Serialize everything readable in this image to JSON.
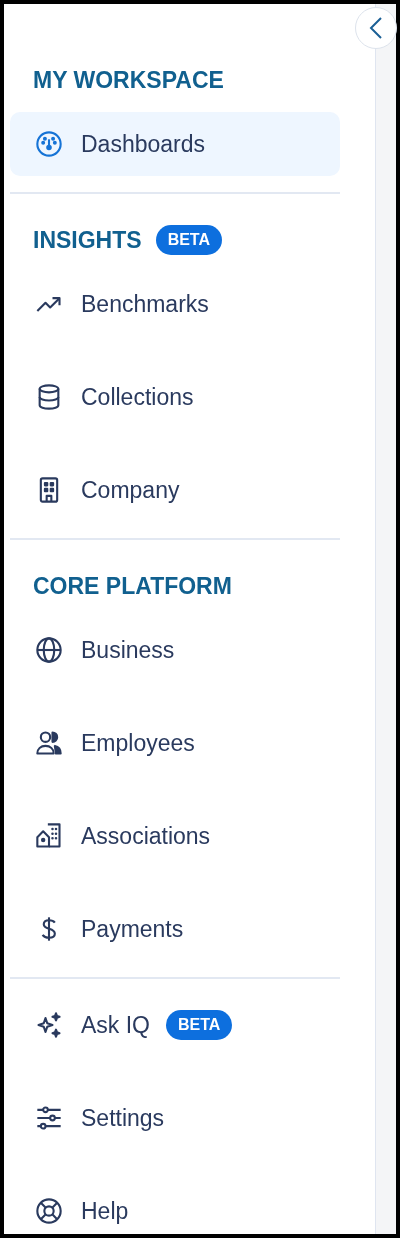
{
  "sections": [
    {
      "title": "MY WORKSPACE",
      "items": [
        {
          "label": "Dashboards",
          "selected": true
        }
      ]
    },
    {
      "title": "INSIGHTS",
      "badge": "BETA",
      "items": [
        {
          "label": "Benchmarks",
          "selected": false
        },
        {
          "label": "Collections",
          "selected": false
        },
        {
          "label": "Company",
          "selected": false
        }
      ]
    },
    {
      "title": "CORE PLATFORM",
      "items": [
        {
          "label": "Business",
          "selected": false
        },
        {
          "label": "Employees",
          "selected": false
        },
        {
          "label": "Associations",
          "selected": false
        },
        {
          "label": "Payments",
          "selected": false
        }
      ]
    },
    {
      "items": [
        {
          "label": "Ask IQ",
          "badge": "BETA",
          "selected": false
        },
        {
          "label": "Settings",
          "selected": false
        },
        {
          "label": "Help",
          "selected": false
        }
      ]
    }
  ]
}
